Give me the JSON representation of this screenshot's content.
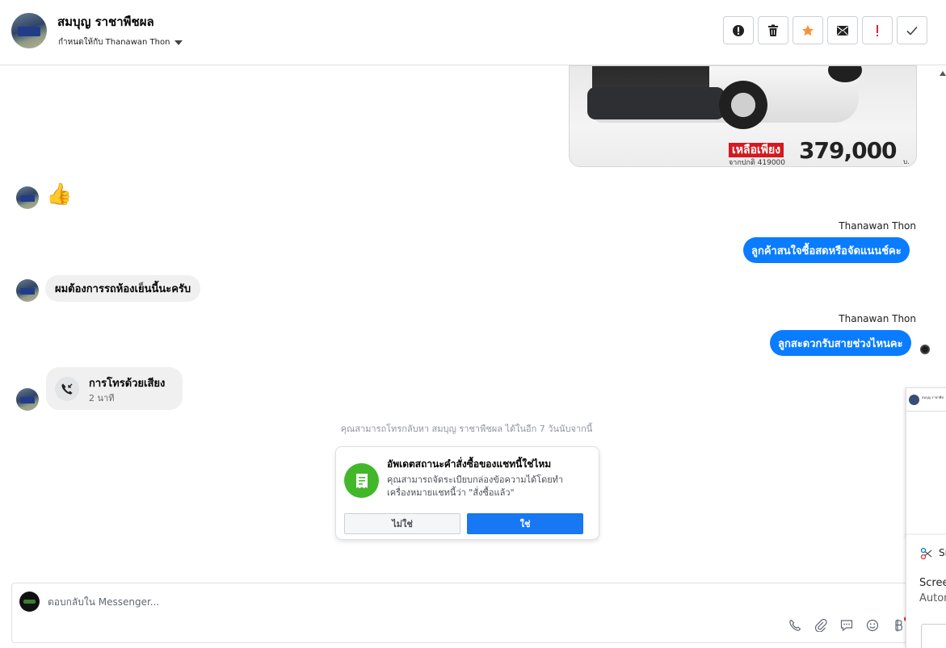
{
  "header": {
    "contact_name": "สมบุญ ราชาพืชผล",
    "assigned_to": "กำหนดให้กับ Thanawan Thon",
    "toolbar": {
      "buttons": [
        {
          "name": "spam-icon"
        },
        {
          "name": "trash-icon"
        },
        {
          "name": "star-icon"
        },
        {
          "name": "mark-unread-icon"
        },
        {
          "name": "important-icon"
        },
        {
          "name": "check-icon"
        }
      ]
    }
  },
  "image_message": {
    "price_tag": "เหลือเพียง",
    "original_price": "จากปกติ 419000",
    "price": "379,000",
    "currency": "บ."
  },
  "messages": {
    "thumb": "👍",
    "out1_sender": "Thanawan Thon",
    "out1_text": "ลูกค้าสนใจซื้อสดหรือจัดแนนช์คะ",
    "in1_text": "ผมต้องการรถห้องเย็นนี้นะครับ",
    "out2_sender": "Thanawan Thon",
    "out2_text": "ลูกสะดวกรับสายช่วงไหนคะ"
  },
  "call": {
    "title": "การโทรด้วยเสียง",
    "duration": "2 นาที"
  },
  "notice": "คุณสามารถโทรกลับหา สมบุญ ราชาพืชผล ได้ในอีก 7 วันนับจากนี้",
  "order_card": {
    "title": "อัพเดตสถานะคำสั่งซื้อของแชทนี้ใช่ไหม",
    "body": "คุณสามารถจัดระเบียบกล่องข้อความได้โดยทำเครื่องหมายแชทนี้ว่า \"สั่งซื้อแล้ว\"",
    "no_label": "ไม่ใช่",
    "yes_label": "ใช่"
  },
  "composer": {
    "placeholder": "ตอบกลับใน Messenger..."
  },
  "side_preview": {
    "mini_text": "สมบุญ ราชาพืช"
  },
  "snip_panel": {
    "app_name": "Sn",
    "line1": "Scree",
    "line2": "Autor"
  }
}
